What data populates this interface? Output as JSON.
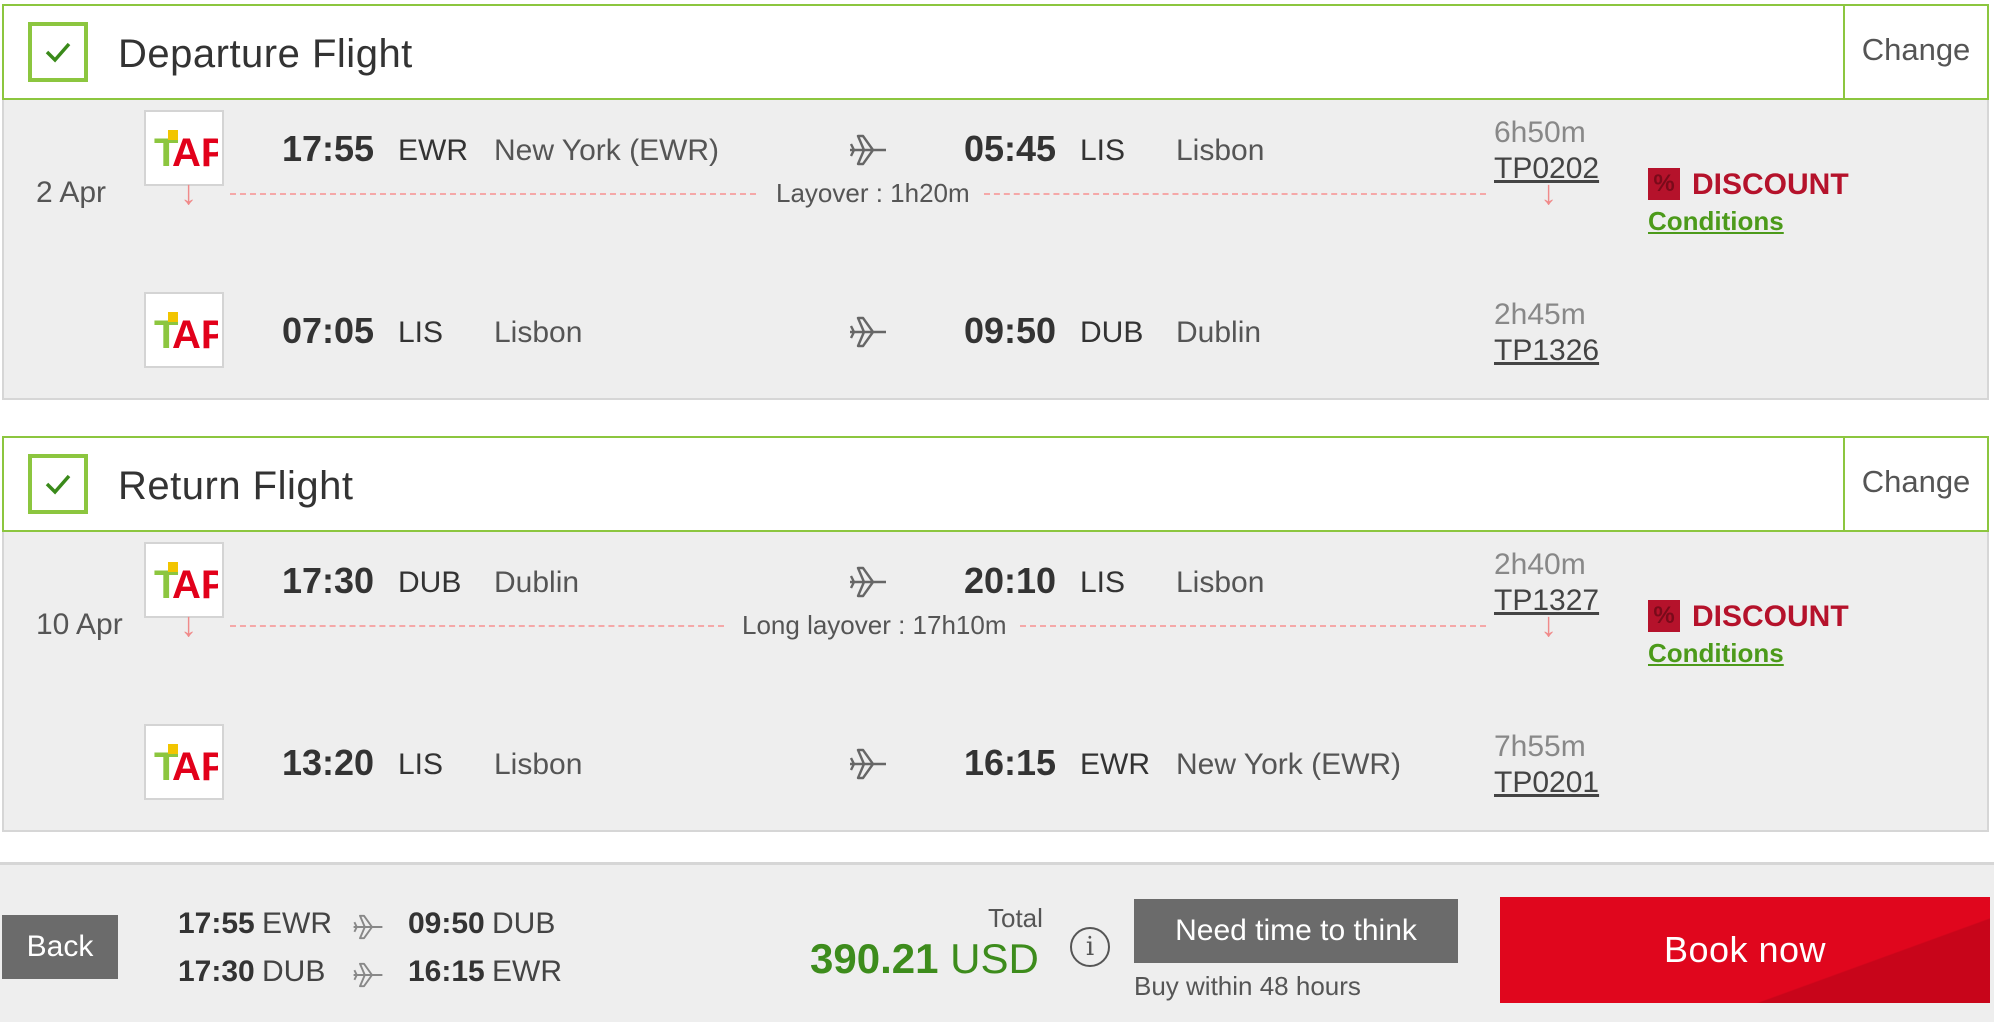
{
  "departure": {
    "title": "Departure Flight",
    "change_label": "Change",
    "date": "2 Apr",
    "layover": "Layover : 1h20m",
    "discount_label": "DISCOUNT",
    "discount_badge": "%",
    "conditions_label": "Conditions",
    "segments": [
      {
        "dep_time": "17:55",
        "dep_code": "EWR",
        "dep_city": "New York (EWR)",
        "arr_time": "05:45",
        "arr_code": "LIS",
        "arr_city": "Lisbon",
        "duration": "6h50m",
        "flight_number": "TP0202"
      },
      {
        "dep_time": "07:05",
        "dep_code": "LIS",
        "dep_city": "Lisbon",
        "arr_time": "09:50",
        "arr_code": "DUB",
        "arr_city": "Dublin",
        "duration": "2h45m",
        "flight_number": "TP1326"
      }
    ]
  },
  "return": {
    "title": "Return Flight",
    "change_label": "Change",
    "date": "10 Apr",
    "layover": "Long layover : 17h10m",
    "discount_label": "DISCOUNT",
    "discount_badge": "%",
    "conditions_label": "Conditions",
    "segments": [
      {
        "dep_time": "17:30",
        "dep_code": "DUB",
        "dep_city": "Dublin",
        "arr_time": "20:10",
        "arr_code": "LIS",
        "arr_city": "Lisbon",
        "duration": "2h40m",
        "flight_number": "TP1327"
      },
      {
        "dep_time": "13:20",
        "dep_code": "LIS",
        "dep_city": "Lisbon",
        "arr_time": "16:15",
        "arr_code": "EWR",
        "arr_city": "New York (EWR)",
        "duration": "7h55m",
        "flight_number": "TP0201"
      }
    ]
  },
  "bottom": {
    "back_label": "Back",
    "summary": [
      {
        "dep_time": "17:55",
        "dep_code": "EWR",
        "arr_time": "09:50",
        "arr_code": "DUB"
      },
      {
        "dep_time": "17:30",
        "dep_code": "DUB",
        "arr_time": "16:15",
        "arr_code": "EWR"
      }
    ],
    "total_label": "Total",
    "price_amount": "390.21",
    "price_currency": "USD",
    "info_icon": "i",
    "think_label": "Need time to think",
    "buy_within": "Buy within 48 hours",
    "book_label": "Book now"
  },
  "colors": {
    "accent_green": "#8cc63f",
    "price_green": "#3d8c1c",
    "book_red": "#e0061d",
    "discount_red": "#b5122b",
    "layover_pink": "#f5a8a8"
  },
  "icons": {
    "check": "check-icon",
    "plane": "plane-icon",
    "arrow_down": "arrow-down-icon",
    "info": "info-icon",
    "airline_logo": "tap-logo"
  }
}
